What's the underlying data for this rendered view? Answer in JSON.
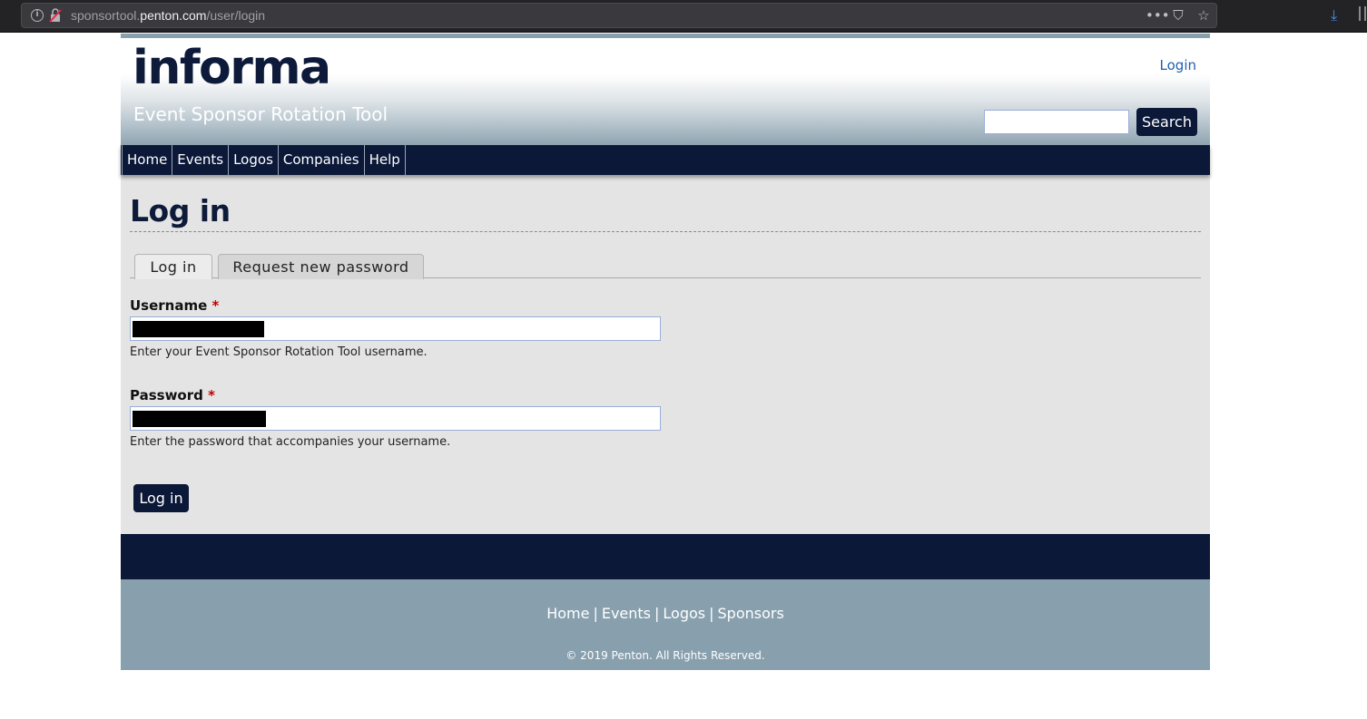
{
  "browser": {
    "url_host": "sponsortool.penton.com",
    "url_path": "/user/login",
    "url_prefix": "sponsortool.",
    "url_domain": "penton.com",
    "icons": [
      "info-icon",
      "insecure-lock-icon",
      "more-icon",
      "pocket-icon",
      "bookmark-star-icon",
      "download-icon",
      "library-icon"
    ]
  },
  "header": {
    "logo": "informa",
    "site_name": "Event Sponsor Rotation Tool",
    "login_link": "Login",
    "search_value": "",
    "search_button": "Search"
  },
  "nav": {
    "items": [
      {
        "label": "Home"
      },
      {
        "label": "Events"
      },
      {
        "label": "Logos"
      },
      {
        "label": "Companies"
      },
      {
        "label": "Help"
      }
    ]
  },
  "main": {
    "title": "Log in",
    "tabs": [
      {
        "label": "Log in",
        "active": true
      },
      {
        "label": "Request new password",
        "active": false
      }
    ],
    "username": {
      "label": "Username",
      "required_mark": "*",
      "value": "[redacted]",
      "description": "Enter your Event Sponsor Rotation Tool username."
    },
    "password": {
      "label": "Password",
      "required_mark": "*",
      "value": "[redacted]",
      "description": "Enter the password that accompanies your username."
    },
    "submit_label": "Log in"
  },
  "footer": {
    "links": [
      {
        "label": "Home"
      },
      {
        "label": "Events"
      },
      {
        "label": "Logos"
      },
      {
        "label": "Sponsors"
      }
    ],
    "separator": "|",
    "copyright": "© 2019 Penton. All Rights Reserved."
  },
  "colors": {
    "brand_navy": "#0b1838",
    "header_steel": "#88a0ae",
    "content_bg": "#e4e4e4",
    "link_blue": "#1f5fb4",
    "required_red": "#c00000"
  }
}
